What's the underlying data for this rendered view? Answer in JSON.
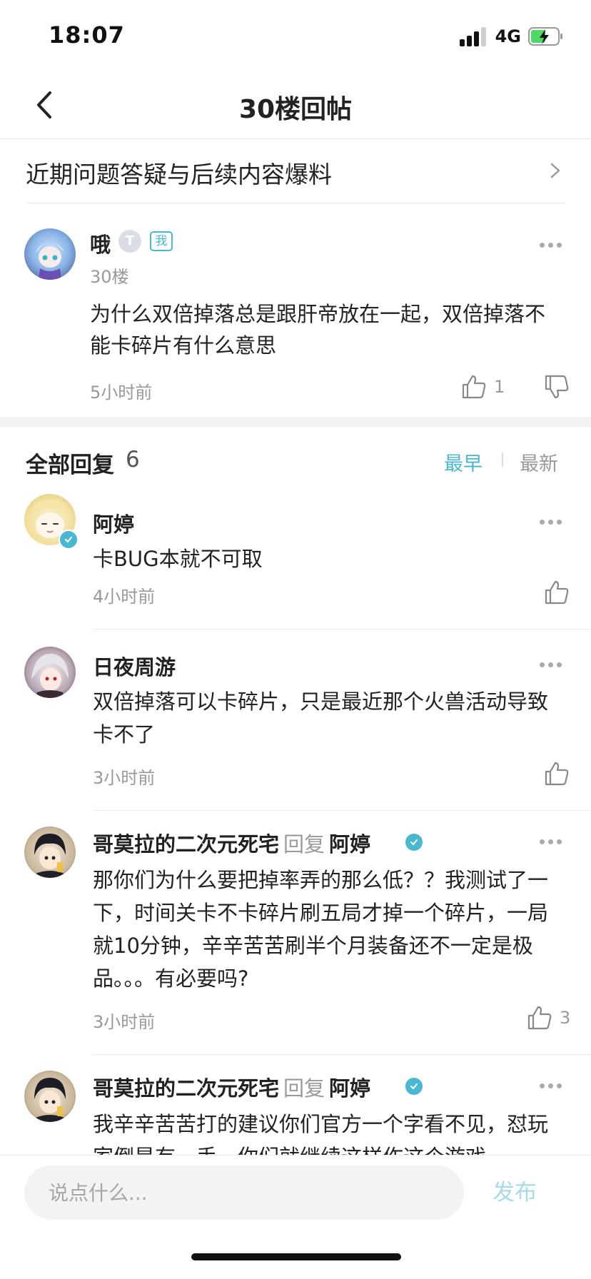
{
  "status_bar": {
    "time": "18:07",
    "network": "4G"
  },
  "nav": {
    "title": "30楼回帖"
  },
  "thread_link": {
    "text": "近期问题答疑与后续内容爆料"
  },
  "main_post": {
    "user_name": "哦",
    "level": "T",
    "self_tag": "我",
    "floor": "30楼",
    "content": "为什么双倍掉落总是跟肝帝放在一起，双倍掉落不能卡碎片有什么意思",
    "time": "5小时前",
    "likes": "1"
  },
  "replies_header": {
    "title": "全部回复",
    "count": "6",
    "sort_earliest": "最早",
    "sort_latest": "最新"
  },
  "replies": [
    {
      "user": "阿婷",
      "content": "卡BUG本就不可取",
      "time": "4小时前",
      "likes": ""
    },
    {
      "user": "日夜周游",
      "content": "双倍掉落可以卡碎片，只是最近那个火兽活动导致卡不了",
      "time": "3小时前",
      "likes": ""
    },
    {
      "user": "哥莫拉的二次元死宅",
      "reply_word": "回复",
      "reply_to": "阿婷",
      "content": "那你们为什么要把掉率弄的那么低？？我测试了一下，时间关卡不卡碎片刷五局才掉一个碎片，一局就10分钟，辛辛苦苦刷半个月装备还不一定是极品。。。有必要吗?",
      "time": "3小时前",
      "likes": "3"
    },
    {
      "user": "哥莫拉的二次元死宅",
      "reply_word": "回复",
      "reply_to": "阿婷",
      "content": "我辛辛苦苦打的建议你们官方一个字看不见，怼玩家倒是有一手，你们就继续这样作这个游戏"
    }
  ],
  "bottom_bar": {
    "input_placeholder": "说点什么...",
    "publish_label": "发布"
  },
  "colors": {
    "accent": "#4ab7d1",
    "muted": "#999999",
    "publish_disabled": "#a8dbe8"
  }
}
